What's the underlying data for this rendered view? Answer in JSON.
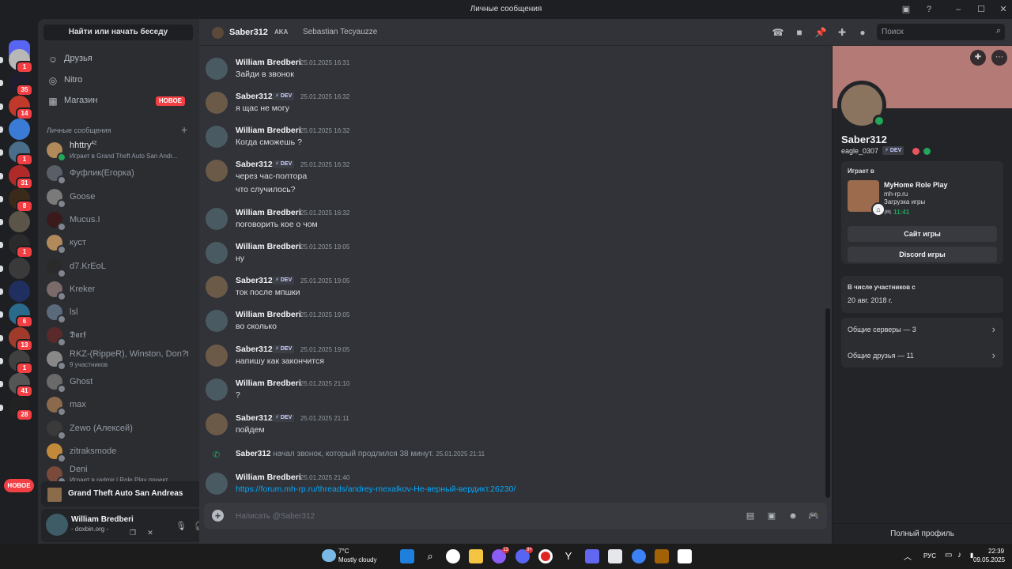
{
  "window": {
    "title": "Личные сообщения"
  },
  "sidebar": {
    "find_button": "Найти или начать беседу",
    "nav": [
      {
        "label": "Друзья",
        "icon": "friends-icon"
      },
      {
        "label": "Nitro",
        "icon": "nitro-icon"
      },
      {
        "label": "Магазин",
        "icon": "shop-icon",
        "badge": "НОВОЕ"
      }
    ],
    "dm_header": "Личные сообщения",
    "dms": [
      {
        "name": "hhttry",
        "sup": "42",
        "sub": "Играет в Grand Theft Auto San Andr..."
      },
      {
        "name": "Фуфлик(Егорка)",
        "sub": ""
      },
      {
        "name": "Goose",
        "sub": ""
      },
      {
        "name": "Mucus.I",
        "sub": ""
      },
      {
        "name": "куст",
        "sub": ""
      },
      {
        "name": "d7.KrEoL",
        "sub": ""
      },
      {
        "name": "Kreker",
        "sub": ""
      },
      {
        "name": "lsl",
        "sub": ""
      },
      {
        "name": "𝕯𝖆𝖗𝖋",
        "sub": ""
      },
      {
        "name": "RKZ-(RippeR), Winston, Don?t...",
        "sub": "9 участников"
      },
      {
        "name": "Ghost",
        "sub": ""
      },
      {
        "name": "max",
        "sub": ""
      },
      {
        "name": "Zewo (Алексей)",
        "sub": ""
      },
      {
        "name": "zitraksmode",
        "sub": ""
      },
      {
        "name": "Deni",
        "sub": "Играет в radmir | Role Play проект"
      }
    ],
    "game_bar": {
      "name": "Grand Theft Auto San Andreas"
    },
    "user": {
      "name": "William Bredberi",
      "status": "- doxbin.org -"
    }
  },
  "servers": {
    "badges": [
      "1",
      "35",
      "14",
      "",
      "1",
      "31",
      "8",
      "",
      "1",
      "",
      "",
      "6",
      "13",
      "1",
      "41",
      "28"
    ],
    "new_label": "НОВОЕ"
  },
  "chat": {
    "header": {
      "name": "Saber312",
      "aka": "AKA",
      "alias": "Sebastian Tecyauzze",
      "search_placeholder": "Поиск"
    },
    "messages": [
      {
        "author": "William Bredberi",
        "dev": false,
        "ts": "25.01.2025 16:31",
        "lines": [
          "Зайди в звонок"
        ]
      },
      {
        "author": "Saber312",
        "dev": true,
        "ts": "25.01.2025 16:32",
        "lines": [
          "я щас не могу"
        ]
      },
      {
        "author": "William Bredberi",
        "dev": false,
        "ts": "25.01.2025 16:32",
        "lines": [
          "Когда сможешь ?"
        ]
      },
      {
        "author": "Saber312",
        "dev": true,
        "ts": "25.01.2025 16:32",
        "lines": [
          "через час-полтора",
          "что случилось?"
        ]
      },
      {
        "author": "William Bredberi",
        "dev": false,
        "ts": "25.01.2025 16:32",
        "lines": [
          "поговорить кое о чом"
        ]
      },
      {
        "author": "William Bredberi",
        "dev": false,
        "ts": "25.01.2025 19:05",
        "lines": [
          "ну"
        ]
      },
      {
        "author": "Saber312",
        "dev": true,
        "ts": "25.01.2025 19:05",
        "lines": [
          "ток после мпшки"
        ]
      },
      {
        "author": "William Bredberi",
        "dev": false,
        "ts": "25.01.2025 19:05",
        "lines": [
          "во сколько"
        ]
      },
      {
        "author": "Saber312",
        "dev": true,
        "ts": "25.01.2025 19:05",
        "lines": [
          "напишу как закончится"
        ]
      },
      {
        "author": "William Bredberi",
        "dev": false,
        "ts": "25.01.2025 21:10",
        "lines": [
          "?"
        ]
      },
      {
        "author": "Saber312",
        "dev": true,
        "ts": "25.01.2025 21:11",
        "lines": [
          "пойдем"
        ]
      }
    ],
    "dev_tag": "⚡ DEV",
    "call": {
      "author": "Saber312",
      "text": "начал звонок, который продлился 38 минут.",
      "ts": "25.01.2025 21:11"
    },
    "last_message": {
      "author": "William Bredberi",
      "ts": "25.01.2025 21:40",
      "link": "https://forum.mh-rp.ru/threads/andrey-mexalkov-Не-верный-вердикт.26230/"
    },
    "composer_placeholder": "Написать @Saber312"
  },
  "profile": {
    "name": "Saber312",
    "handle": "eagle_0307",
    "dev_tag": "⚡ DEV",
    "banner_color": "#b47a76",
    "playing_label": "Играет в",
    "game": {
      "title": "MyHome Role Play",
      "host": "mh-rp.ru",
      "state": "Загрузка игры",
      "time": "🎮 11:41"
    },
    "buttons": [
      "Сайт игры",
      "Discord игры"
    ],
    "member_label": "В числе участников с",
    "member_date": "20 авг. 2018 г.",
    "servers_row": "Общие серверы — 3",
    "friends_row": "Общие друзья — 11",
    "full_profile": "Полный профиль"
  },
  "taskbar": {
    "weather_temp": "7°C",
    "weather_state": "Mostly cloudy",
    "lang": "РУС",
    "time": "22:39",
    "date": "09.05.2025"
  }
}
